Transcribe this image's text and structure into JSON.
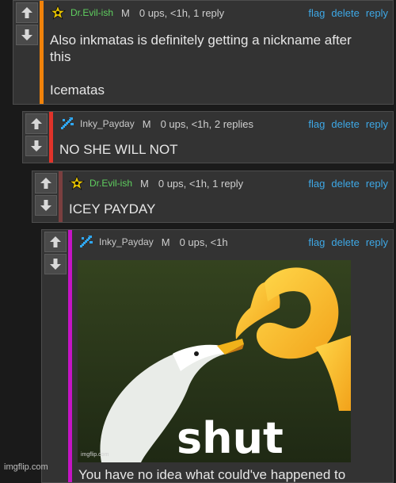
{
  "comments": [
    {
      "username": "Dr.Evil-ish",
      "badge": "M",
      "stats": "0 ups, <1h, 1 reply",
      "user_color": "#5fcf5f",
      "bar_color": "#f0820a",
      "lines": [
        "Also inkmatas is definitely getting a nickname after",
        "this",
        "",
        "Icematas"
      ]
    },
    {
      "username": "Inky_Payday",
      "badge": "M",
      "stats": "0 ups, <1h, 2 replies",
      "user_color": "#c9c9c9",
      "bar_color": "#e0332a",
      "lines": [
        "NO SHE WILL NOT"
      ]
    },
    {
      "username": "Dr.Evil-ish",
      "badge": "M",
      "stats": "0 ups, <1h, 1 reply",
      "user_color": "#5fcf5f",
      "bar_color": "#7a3f3f",
      "lines": [
        "ICEY PAYDAY"
      ]
    },
    {
      "username": "Inky_Payday",
      "badge": "M",
      "stats": "0 ups, <1h",
      "user_color": "#c9c9c9",
      "bar_color": "#c514c5",
      "lines": []
    }
  ],
  "actions": {
    "flag": "flag",
    "delete": "delete",
    "reply": "reply"
  },
  "meme": {
    "caption": "shut",
    "small_mark": "imgflip.com"
  },
  "trailing_text": "You have no idea what could've happened to",
  "watermark": "imgflip.com",
  "icons": {
    "upvote": "arrow-up-icon",
    "downvote": "arrow-down-icon",
    "dr_evil_avatar": "star-figure-icon",
    "inky_avatar": "pixel-squid-icon"
  }
}
